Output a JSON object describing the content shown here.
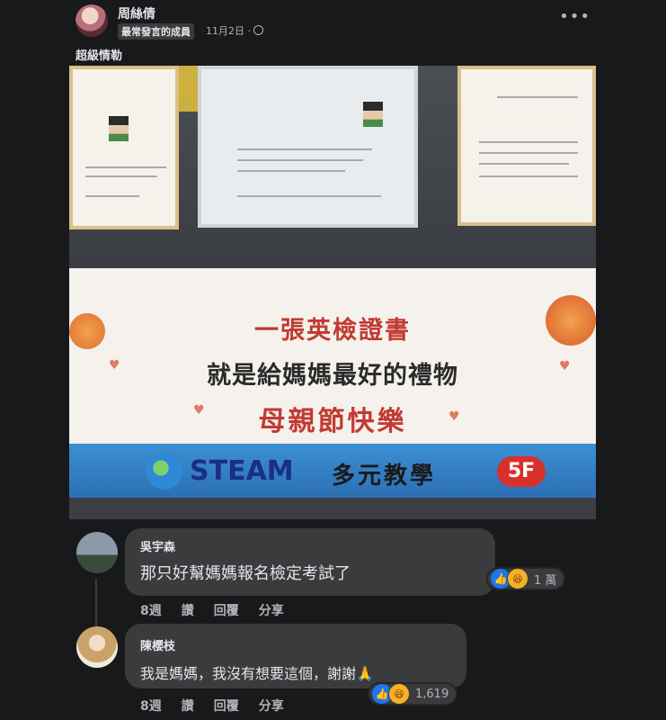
{
  "post": {
    "author": "周絲倩",
    "badge": "最常發言的成員",
    "time": "11月2日 ·",
    "privacy_icon": "globe-icon",
    "more_icon": "more-dots-icon",
    "more_label": "•••",
    "text": "超級情勒"
  },
  "photo": {
    "banner_line1": "一張英檢證書",
    "banner_line2": "就是給媽媽最好的禮物",
    "banner_line3": "母親節快樂",
    "brand": "STEAM",
    "brand_sub": "多元教學",
    "floor": "5F"
  },
  "comments": [
    {
      "name": "吳宇森",
      "text": "那只好幫媽媽報名檢定考試了",
      "reactions": {
        "icons": [
          "like-icon",
          "haha-icon"
        ],
        "count": "1 萬"
      },
      "actions": {
        "time": "8週",
        "like": "讚",
        "reply": "回覆",
        "share": "分享"
      }
    },
    {
      "name": "陳櫻枝",
      "text": "我是媽媽，我沒有想要這個，謝謝🙏",
      "reactions": {
        "icons": [
          "like-icon",
          "haha-icon"
        ],
        "count": "1,619"
      },
      "actions": {
        "time": "8週",
        "like": "讚",
        "reply": "回覆",
        "share": "分享"
      }
    }
  ],
  "colors": {
    "background": "#18191a",
    "bubble": "#3a3b3c",
    "like": "#1877f2",
    "banner_red": "#c23a32",
    "banner_blue": "#2c6fb3"
  }
}
